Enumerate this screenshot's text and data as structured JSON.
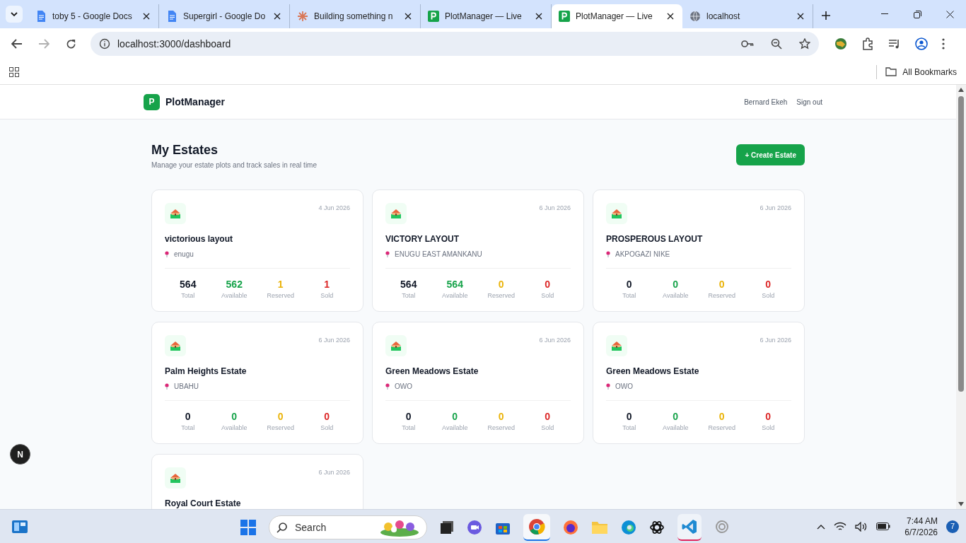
{
  "browser": {
    "tabs": [
      {
        "title": "toby 5 - Google Docs",
        "kind": "docs",
        "selected": false
      },
      {
        "title": "Supergirl - Google Do",
        "kind": "docs",
        "selected": false
      },
      {
        "title": "Building something n",
        "kind": "burst",
        "selected": false
      },
      {
        "title": "PlotManager — Live",
        "kind": "plot",
        "selected": false
      },
      {
        "title": "PlotManager — Live",
        "kind": "plot",
        "selected": true
      },
      {
        "title": "localhost",
        "kind": "globe",
        "selected": false
      }
    ],
    "url": "localhost:3000/dashboard",
    "bookmarks_label": "All Bookmarks"
  },
  "app": {
    "brand": "PlotManager",
    "brand_letter": "P",
    "user": "Bernard Ekeh",
    "sign_out": "Sign out",
    "title": "My Estates",
    "subtitle": "Manage your estate plots and track sales in real time",
    "create_button": "+ Create Estate",
    "estates": [
      {
        "name": "victorious layout",
        "date": "4 Jun 2026",
        "location": "enugu",
        "stats": [
          {
            "kind": "total",
            "value": "564",
            "label": "Total"
          },
          {
            "kind": "available",
            "value": "562",
            "label": "Available"
          },
          {
            "kind": "reserved",
            "value": "1",
            "label": "Reserved"
          },
          {
            "kind": "sold",
            "value": "1",
            "label": "Sold"
          }
        ]
      },
      {
        "name": "VICTORY LAYOUT",
        "date": "6 Jun 2026",
        "location": "ENUGU EAST AMANKANU",
        "stats": [
          {
            "kind": "total",
            "value": "564",
            "label": "Total"
          },
          {
            "kind": "available",
            "value": "564",
            "label": "Available"
          },
          {
            "kind": "reserved",
            "value": "0",
            "label": "Reserved"
          },
          {
            "kind": "sold",
            "value": "0",
            "label": "Sold"
          }
        ]
      },
      {
        "name": "PROSPEROUS LAYOUT",
        "date": "6 Jun 2026",
        "location": "AKPOGAZI NIKE",
        "stats": [
          {
            "kind": "total",
            "value": "0",
            "label": "Total"
          },
          {
            "kind": "available",
            "value": "0",
            "label": "Available"
          },
          {
            "kind": "reserved",
            "value": "0",
            "label": "Reserved"
          },
          {
            "kind": "sold",
            "value": "0",
            "label": "Sold"
          }
        ]
      },
      {
        "name": "Palm Heights Estate",
        "date": "6 Jun 2026",
        "location": "UBAHU",
        "stats": [
          {
            "kind": "total",
            "value": "0",
            "label": "Total"
          },
          {
            "kind": "available",
            "value": "0",
            "label": "Available"
          },
          {
            "kind": "reserved",
            "value": "0",
            "label": "Reserved"
          },
          {
            "kind": "sold",
            "value": "0",
            "label": "Sold"
          }
        ]
      },
      {
        "name": "Green Meadows Estate",
        "date": "6 Jun 2026",
        "location": "OWO",
        "stats": [
          {
            "kind": "total",
            "value": "0",
            "label": "Total"
          },
          {
            "kind": "available",
            "value": "0",
            "label": "Available"
          },
          {
            "kind": "reserved",
            "value": "0",
            "label": "Reserved"
          },
          {
            "kind": "sold",
            "value": "0",
            "label": "Sold"
          }
        ]
      },
      {
        "name": "Green Meadows Estate",
        "date": "6 Jun 2026",
        "location": "OWO",
        "stats": [
          {
            "kind": "total",
            "value": "0",
            "label": "Total"
          },
          {
            "kind": "available",
            "value": "0",
            "label": "Available"
          },
          {
            "kind": "reserved",
            "value": "0",
            "label": "Reserved"
          },
          {
            "kind": "sold",
            "value": "0",
            "label": "Sold"
          }
        ]
      },
      {
        "name": "Royal Court Estate",
        "date": "6 Jun 2026"
      }
    ],
    "dev_badge": "N"
  },
  "taskbar": {
    "search": "Search",
    "time": "7:44 AM",
    "date": "6/7/2026",
    "notifications": "7"
  }
}
